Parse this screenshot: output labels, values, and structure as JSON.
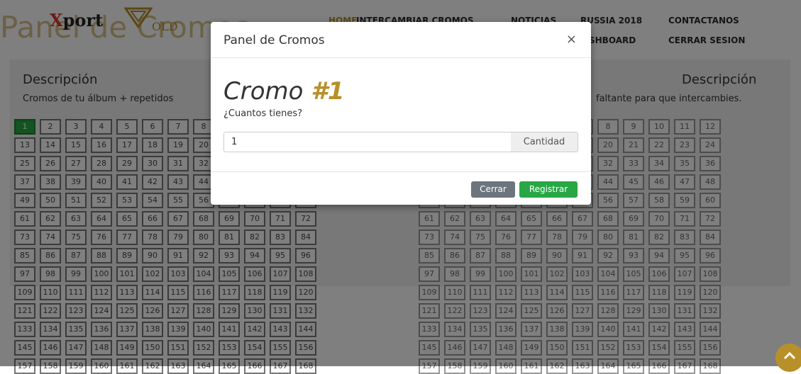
{
  "brand": {
    "x": "X",
    "name": "port",
    "old": "OLD"
  },
  "page_title": "Panel de Cromos",
  "nav": {
    "home": "HOME",
    "intercambiar": "INTERCAMBIAR CROMOS",
    "noticias": "NOTICIAS",
    "russia": "RUSSIA 2018",
    "contactanos": "CONTACTANOS",
    "dashboard": "SHBOARD",
    "cerrar_sesion": "CERRAR SESION"
  },
  "left_panel": {
    "title": "Descripción",
    "subtitle": "Cromos de tu álbum + repetidos"
  },
  "right_panel": {
    "title": "Descripción",
    "subtitle": "faltante para que intercambies."
  },
  "stickers": {
    "first": 1,
    "last": 168,
    "selected": 1
  },
  "modal": {
    "title": "Panel de Cromos",
    "close_symbol": "×",
    "heading_prefix": "Cromo ",
    "heading_number": "#1",
    "question": "¿Cuantos tienes?",
    "quantity_value": "1",
    "quantity_addon": "Cantidad",
    "close_button": "Cerrar",
    "register_button": "Registrar"
  },
  "icons": {
    "scroll_top": "chevron-up-icon"
  },
  "colors": {
    "accent_gold": "#b8902a",
    "active_green": "#28a745",
    "backdrop": "rgba(0,0,0,0.5)"
  }
}
